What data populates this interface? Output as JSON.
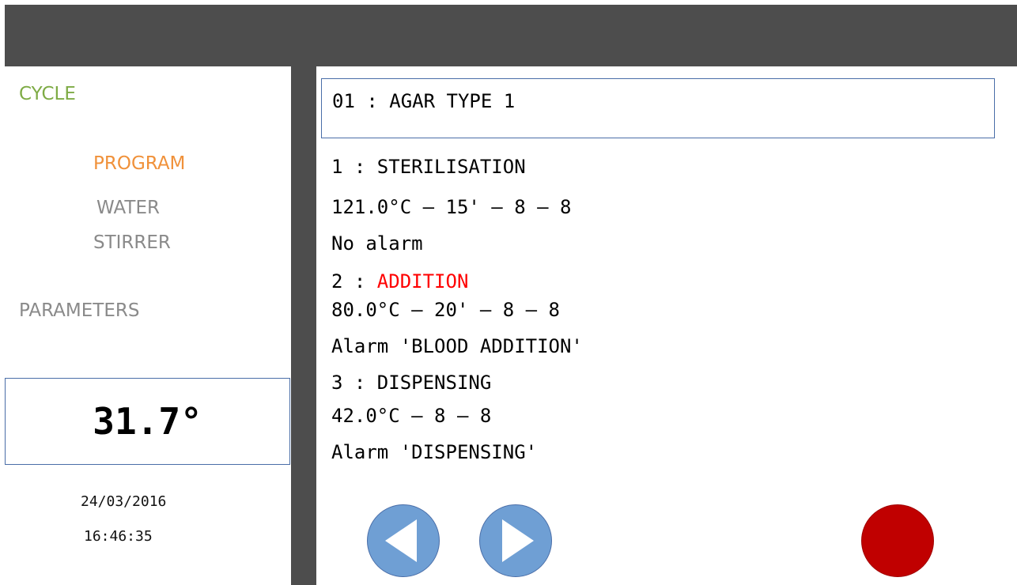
{
  "sidebar": {
    "cycle": "CYCLE",
    "program": "PROGRAM",
    "water": "WATER",
    "stirrer": "STIRRER",
    "parameters": "PARAMETERS",
    "temperature": "31.7°",
    "date": "24/03/2016",
    "time": "16:46:35"
  },
  "main": {
    "program_title": "01 : AGAR TYPE 1",
    "steps": [
      {
        "number_prefix": "1 : ",
        "name": "STERILISATION",
        "params": "121.0°C – 15' – 8 – 8",
        "alarm": "No alarm"
      },
      {
        "number_prefix": "2 : ",
        "name": "ADDITION",
        "params": "80.0°C – 20' – 8 – 8",
        "alarm": "Alarm 'BLOOD ADDITION'"
      },
      {
        "number_prefix": "3 : ",
        "name": "DISPENSING",
        "params": "42.0°C – 8 – 8",
        "alarm": "Alarm 'DISPENSING'"
      }
    ]
  },
  "controls": {
    "prev_icon": "triangle-left-icon",
    "next_icon": "triangle-right-icon",
    "stop_icon": "red-circle-icon"
  },
  "colors": {
    "header": "#4d4d4d",
    "cycle": "#7eab45",
    "program": "#f0913a",
    "inactive_menu": "#8a8a8a",
    "active_step": "#ff0000",
    "nav_button": "#6f9fd4",
    "stop_button": "#c00000"
  }
}
